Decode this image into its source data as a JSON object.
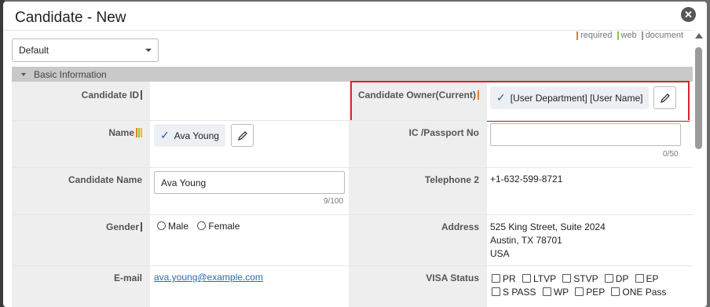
{
  "modal": {
    "title": "Candidate - New",
    "close_label": "✕"
  },
  "legend": {
    "items": [
      {
        "label": "required",
        "color": "#e67e22"
      },
      {
        "label": "web",
        "color": "#8cc63f"
      },
      {
        "label": "document",
        "color": "#999999"
      }
    ]
  },
  "preset": {
    "value": "Default"
  },
  "section": {
    "title": "Basic Information"
  },
  "fields": {
    "candidate_id": {
      "label": "Candidate ID"
    },
    "owner": {
      "label": "Candidate Owner(Current)",
      "value": "[User Department] [User Name]"
    },
    "name": {
      "label": "Name",
      "value": "Ava Young"
    },
    "passport": {
      "label": "IC /Passport No",
      "value": "",
      "counter": "0/50"
    },
    "candidate_name": {
      "label": "Candidate Name",
      "value": "Ava Young",
      "counter": "9/100"
    },
    "telephone2": {
      "label": "Telephone 2",
      "value": "+1-632-599-8721"
    },
    "gender": {
      "label": "Gender",
      "options": [
        "Male",
        "Female"
      ]
    },
    "address": {
      "label": "Address",
      "line1": "525 King Street, Suite 2024",
      "line2": "Austin, TX 78701",
      "line3": "USA"
    },
    "email": {
      "label": "E-mail",
      "value": "ava.young@example.com"
    },
    "visa": {
      "label": "VISA Status",
      "options": [
        "PR",
        "LTVP",
        "STVP",
        "DP",
        "EP",
        "S PASS",
        "WP",
        "PEP",
        "ONE Pass"
      ]
    }
  },
  "icons": {
    "check": "check-icon",
    "edit": "pencil-icon",
    "close": "close-icon"
  }
}
